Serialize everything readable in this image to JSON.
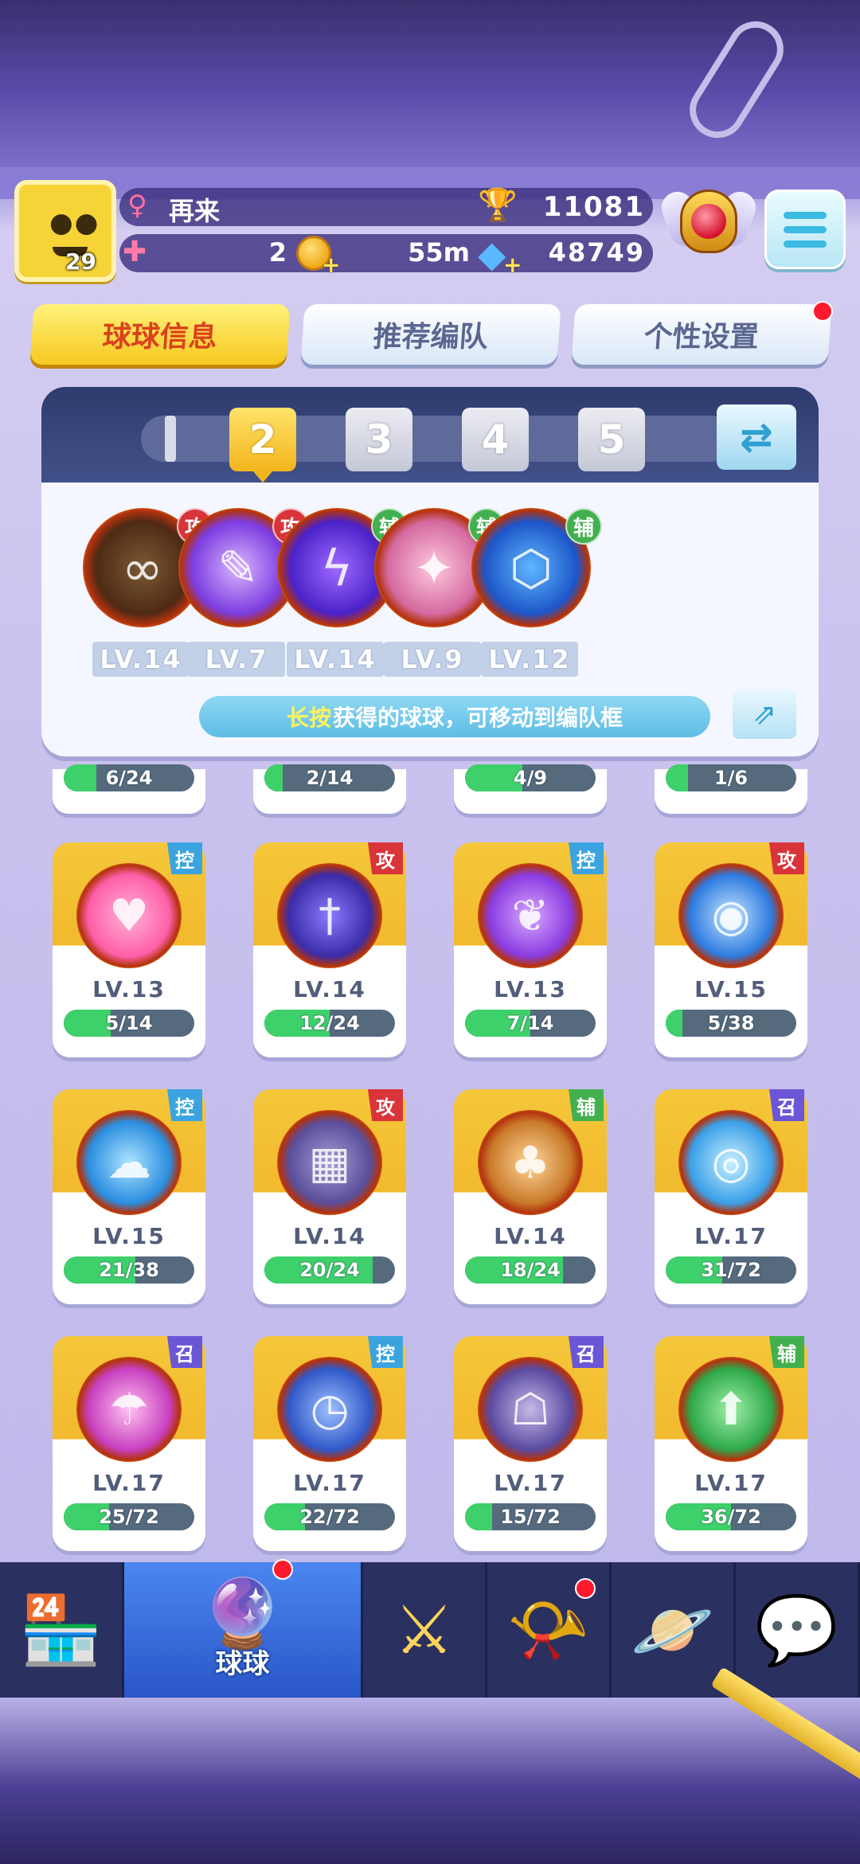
{
  "player": {
    "name": "再来",
    "gender_icon": "female-icon",
    "level": "29",
    "trophies": "11081",
    "tickets": "2",
    "coin_timer": "55m",
    "gems": "48749"
  },
  "tabs": [
    {
      "label": "球球信息",
      "active": true
    },
    {
      "label": "推荐编队",
      "active": false
    },
    {
      "label": "个性设置",
      "active": false,
      "notification": true
    }
  ],
  "team": {
    "slots": [
      "1",
      "2",
      "3",
      "4",
      "5"
    ],
    "active_slot": "2",
    "balls": [
      {
        "icon": "infinity-ball-icon",
        "role": "攻",
        "level": "LV.14"
      },
      {
        "icon": "shark-ball-icon",
        "role": "攻",
        "level": "LV.7"
      },
      {
        "icon": "lightning-ball-icon",
        "role": "辅",
        "level": "LV.14"
      },
      {
        "icon": "muscle-ball-icon",
        "role": "辅",
        "level": "LV.9"
      },
      {
        "icon": "hexagon-ball-icon",
        "role": "辅",
        "level": "LV.12"
      }
    ],
    "hint_highlight": "长按",
    "hint_text": "获得的球球，可移动到编队框"
  },
  "partial_row": [
    {
      "progress": "6/24",
      "fill": 0.25
    },
    {
      "progress": "2/14",
      "fill": 0.14
    },
    {
      "progress": "4/9",
      "fill": 0.44
    },
    {
      "progress": "1/6",
      "fill": 0.17
    }
  ],
  "grid": [
    {
      "icon": "heart-ball-icon",
      "role": "控",
      "level": "LV.13",
      "progress": "5/14",
      "fill": 0.36
    },
    {
      "icon": "sword-ball-icon",
      "role": "攻",
      "level": "LV.14",
      "progress": "12/24",
      "fill": 0.5
    },
    {
      "icon": "butterfly-ball-icon",
      "role": "控",
      "level": "LV.13",
      "progress": "7/14",
      "fill": 0.5
    },
    {
      "icon": "orb-ball-icon",
      "role": "攻",
      "level": "LV.15",
      "progress": "5/38",
      "fill": 0.13
    },
    {
      "icon": "cloud-ball-icon",
      "role": "控",
      "level": "LV.15",
      "progress": "21/38",
      "fill": 0.55
    },
    {
      "icon": "cross-ball-icon",
      "role": "攻",
      "level": "LV.14",
      "progress": "20/24",
      "fill": 0.83
    },
    {
      "icon": "people-ball-icon",
      "role": "辅",
      "level": "LV.14",
      "progress": "18/24",
      "fill": 0.75
    },
    {
      "icon": "vortex-ball-icon",
      "role": "召",
      "level": "LV.17",
      "progress": "31/72",
      "fill": 0.43
    },
    {
      "icon": "mushroom-ball-icon",
      "role": "召",
      "level": "LV.17",
      "progress": "25/72",
      "fill": 0.35
    },
    {
      "icon": "clock-ball-icon",
      "role": "控",
      "level": "LV.17",
      "progress": "22/72",
      "fill": 0.31
    },
    {
      "icon": "ghost-ball-icon",
      "role": "召",
      "level": "LV.17",
      "progress": "15/72",
      "fill": 0.21
    },
    {
      "icon": "arrow-ball-icon",
      "role": "辅",
      "level": "LV.17",
      "progress": "36/72",
      "fill": 0.5
    }
  ],
  "nav": [
    {
      "icon": "shop-icon",
      "label": "",
      "active": false
    },
    {
      "icon": "ball-jar-icon",
      "label": "球球",
      "active": true,
      "notification": true
    },
    {
      "icon": "crossed-swords-icon",
      "label": "",
      "active": false
    },
    {
      "icon": "whistle-icon",
      "label": "",
      "active": false,
      "notification": true
    },
    {
      "icon": "planet-icon",
      "label": "",
      "active": false
    },
    {
      "icon": "social-heart-icon",
      "label": "",
      "active": false
    }
  ],
  "colors": {
    "role_attack": "#d8343a",
    "role_support": "#43b04f",
    "role_control": "#3ba4e0",
    "role_summon": "#6a56d6",
    "progress_fill": "#3ed06a",
    "active_tab": "#f7c820"
  }
}
